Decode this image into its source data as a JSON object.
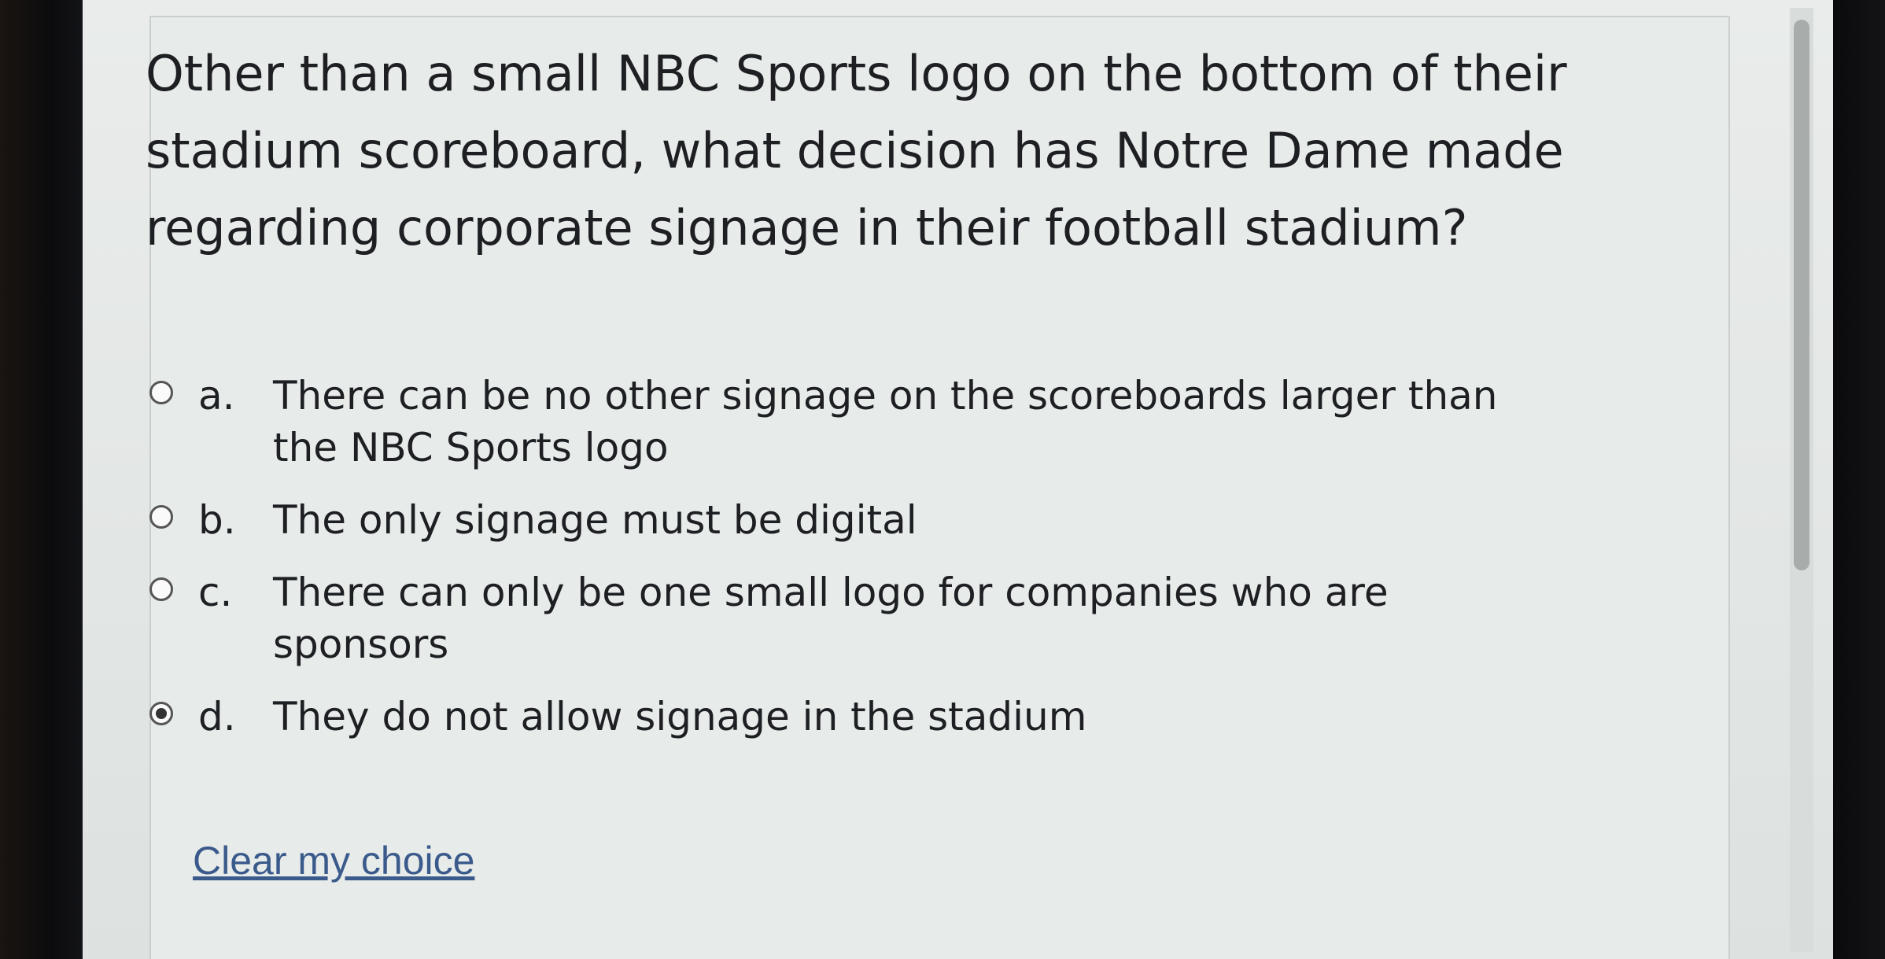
{
  "question": {
    "text": "Other than a small NBC Sports logo on the bottom of their stadium scoreboard, what decision has Notre Dame made regarding corporate signage in their football stadium?"
  },
  "answers": [
    {
      "letter": "a.",
      "text": "There can be no other signage on the scoreboards larger than the NBC Sports logo",
      "selected": false
    },
    {
      "letter": "b.",
      "text": "The only signage must be digital",
      "selected": false
    },
    {
      "letter": "c.",
      "text": "There can only be one small logo for companies who are sponsors",
      "selected": false
    },
    {
      "letter": "d.",
      "text": "They do not allow signage in the stadium",
      "selected": true
    }
  ],
  "clear_link": {
    "label": "Clear my choice"
  },
  "colors": {
    "link": "#3b5a8c",
    "text": "#1d1f22",
    "background": "#e7ebe9"
  }
}
